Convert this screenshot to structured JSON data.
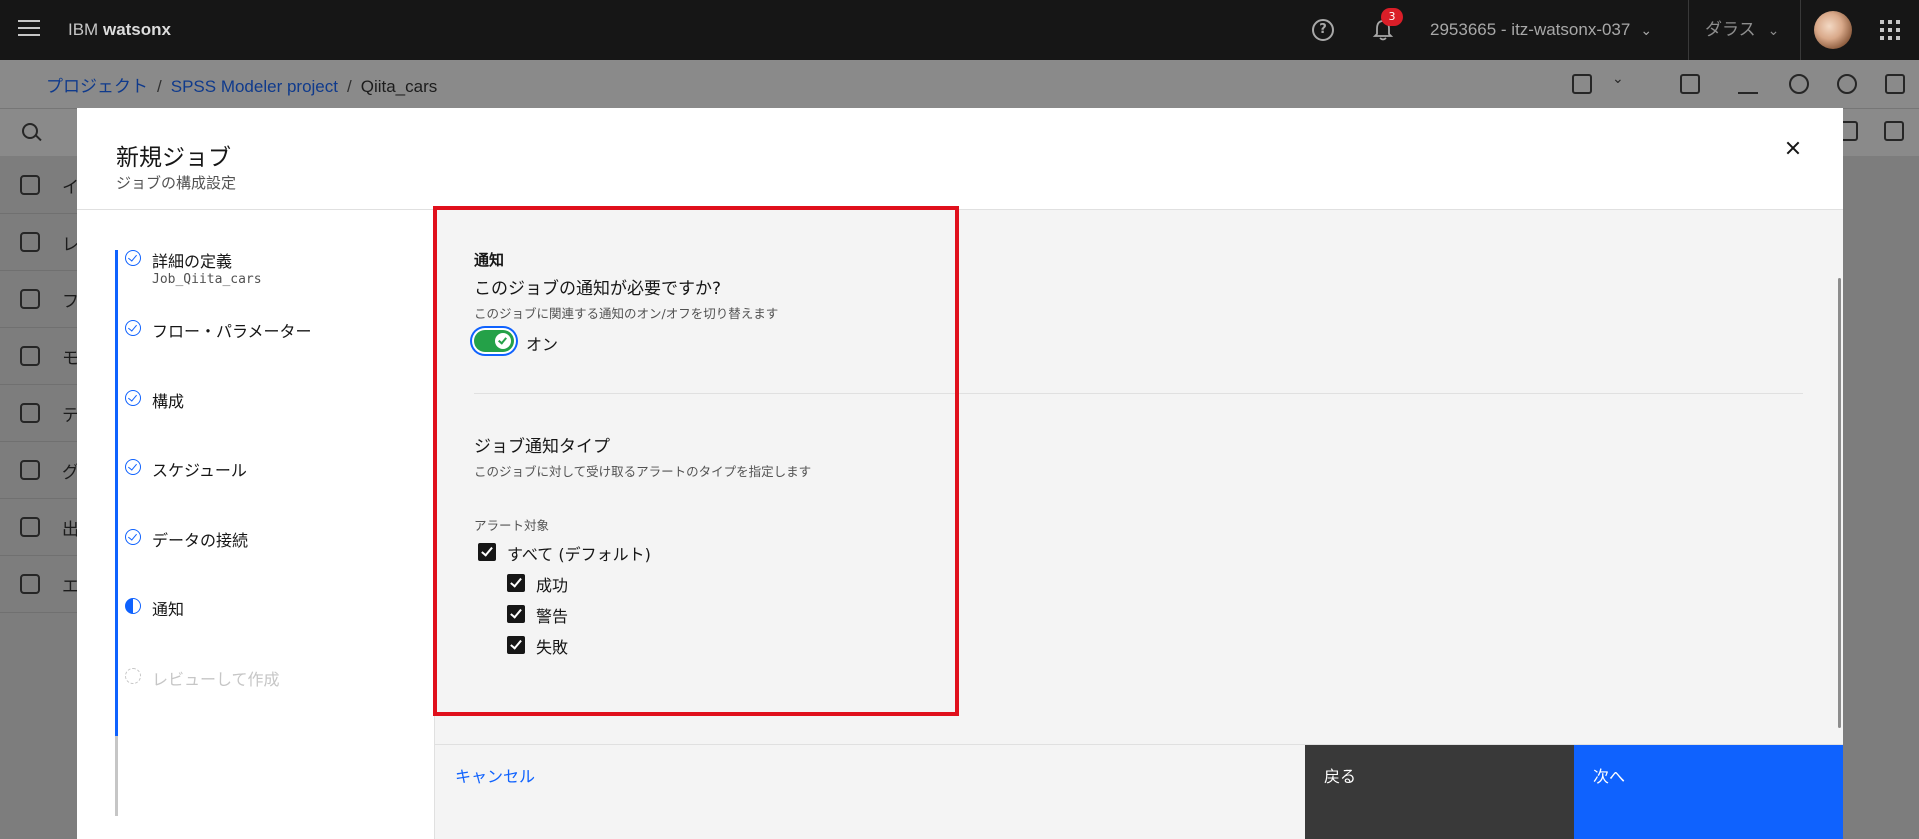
{
  "header": {
    "brand_prefix": "IBM",
    "brand_name": "watsonx",
    "notification_count": "3",
    "account": "2953665 - itz-watsonx-037",
    "region": "ダラス"
  },
  "breadcrumb": {
    "items": [
      "プロジェクト",
      "SPSS Modeler project"
    ],
    "current": "Qiita_cars"
  },
  "background_nav": {
    "items": [
      "イ",
      "レ",
      "フ",
      "モ",
      "テ",
      "グ",
      "出",
      "エ"
    ]
  },
  "modal": {
    "title": "新規ジョブ",
    "subtitle": "ジョブの構成設定",
    "steps": [
      {
        "label": "詳細の定義",
        "sub": "Job_Qiita_cars",
        "state": "complete"
      },
      {
        "label": "フロー・パラメーター",
        "state": "complete"
      },
      {
        "label": "構成",
        "state": "complete"
      },
      {
        "label": "スケジュール",
        "state": "complete"
      },
      {
        "label": "データの接続",
        "state": "complete"
      },
      {
        "label": "通知",
        "state": "current"
      },
      {
        "label": "レビューして作成",
        "state": "incomplete"
      }
    ],
    "notification": {
      "section_label": "通知",
      "question": "このジョブの通知が必要ですか?",
      "question_help": "このジョブに関連する通知のオン/オフを切り替えます",
      "toggle_state": "on",
      "toggle_label": "オン",
      "type_heading": "ジョブ通知タイプ",
      "type_help": "このジョブに対して受け取るアラートのタイプを指定します",
      "alert_label": "アラート対象",
      "options": [
        {
          "label": "すべて (デフォルト)",
          "checked": true
        },
        {
          "label": "成功",
          "checked": true
        },
        {
          "label": "警告",
          "checked": true
        },
        {
          "label": "失敗",
          "checked": true
        }
      ]
    },
    "footer": {
      "cancel": "キャンセル",
      "back": "戻る",
      "next": "次へ"
    }
  },
  "colors": {
    "primary_blue": "#0f62fe",
    "toggle_green": "#24a148",
    "highlight_red": "#e0101c",
    "header_bg": "#161616"
  }
}
